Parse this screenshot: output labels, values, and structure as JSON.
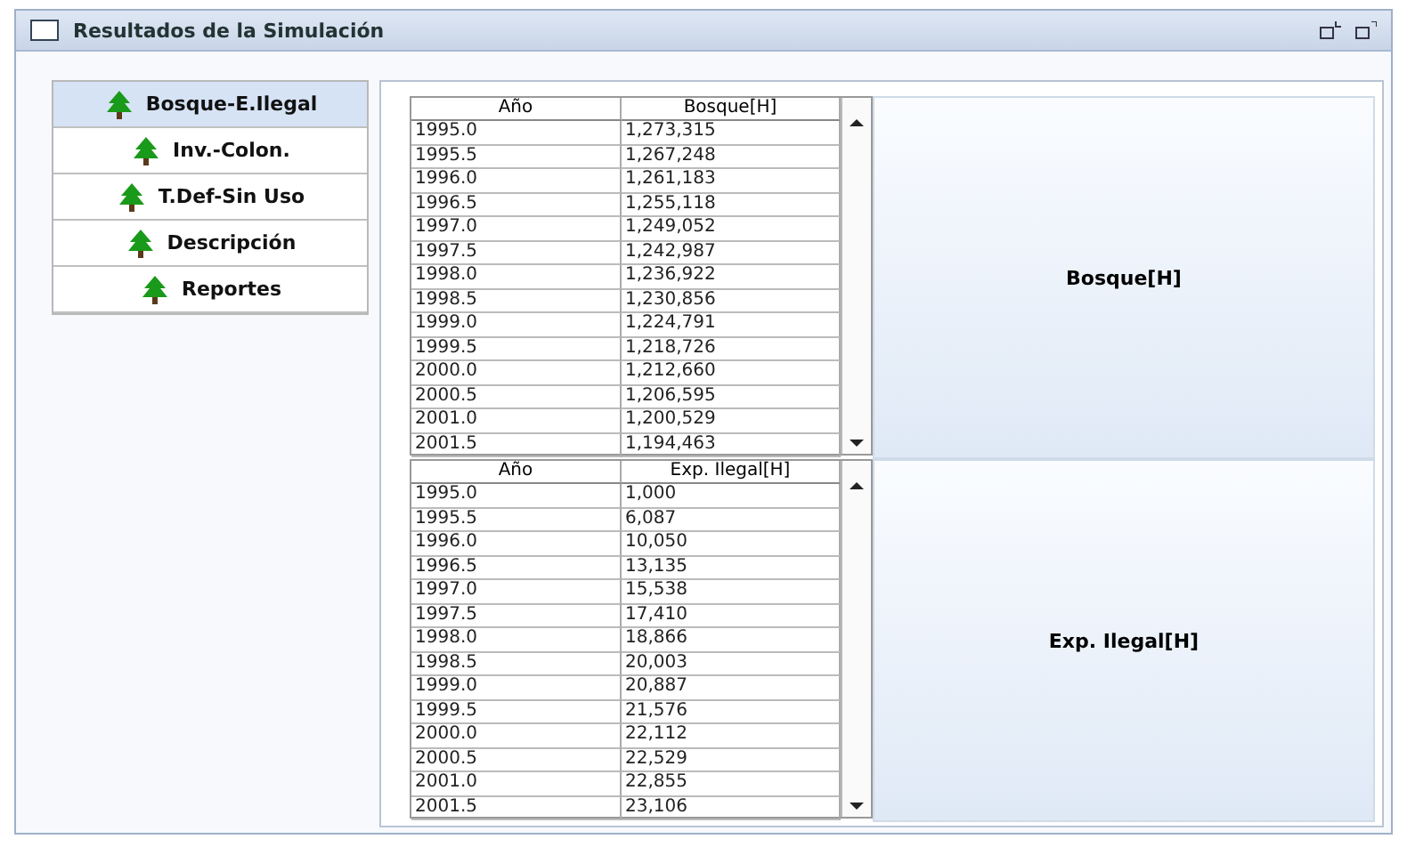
{
  "window": {
    "title": "Resultados de la Simulación"
  },
  "tabs": [
    {
      "label": "Bosque-E.Ilegal",
      "selected": true
    },
    {
      "label": "Inv.-Colon.",
      "selected": false
    },
    {
      "label": "T.Def-Sin Uso",
      "selected": false
    },
    {
      "label": "Descripción",
      "selected": false
    },
    {
      "label": "Reportes",
      "selected": false
    }
  ],
  "panels": [
    {
      "table": {
        "columns": [
          "Año",
          "Bosque[H]"
        ],
        "rows": [
          [
            "1995.0",
            "1,273,315"
          ],
          [
            "1995.5",
            "1,267,248"
          ],
          [
            "1996.0",
            "1,261,183"
          ],
          [
            "1996.5",
            "1,255,118"
          ],
          [
            "1997.0",
            "1,249,052"
          ],
          [
            "1997.5",
            "1,242,987"
          ],
          [
            "1998.0",
            "1,236,922"
          ],
          [
            "1998.5",
            "1,230,856"
          ],
          [
            "1999.0",
            "1,224,791"
          ],
          [
            "1999.5",
            "1,218,726"
          ],
          [
            "2000.0",
            "1,212,660"
          ],
          [
            "2000.5",
            "1,206,595"
          ],
          [
            "2001.0",
            "1,200,529"
          ],
          [
            "2001.5",
            "1,194,463"
          ]
        ]
      },
      "chart_label": "Bosque[H]"
    },
    {
      "table": {
        "columns": [
          "Año",
          "Exp. Ilegal[H]"
        ],
        "rows": [
          [
            "1995.0",
            "1,000"
          ],
          [
            "1995.5",
            "6,087"
          ],
          [
            "1996.0",
            "10,050"
          ],
          [
            "1996.5",
            "13,135"
          ],
          [
            "1997.0",
            "15,538"
          ],
          [
            "1997.5",
            "17,410"
          ],
          [
            "1998.0",
            "18,866"
          ],
          [
            "1998.5",
            "20,003"
          ],
          [
            "1999.0",
            "20,887"
          ],
          [
            "1999.5",
            "21,576"
          ],
          [
            "2000.0",
            "22,112"
          ],
          [
            "2000.5",
            "22,529"
          ],
          [
            "2001.0",
            "22,855"
          ],
          [
            "2001.5",
            "23,106"
          ]
        ]
      },
      "chart_label": "Exp. Ilegal[H]"
    }
  ]
}
